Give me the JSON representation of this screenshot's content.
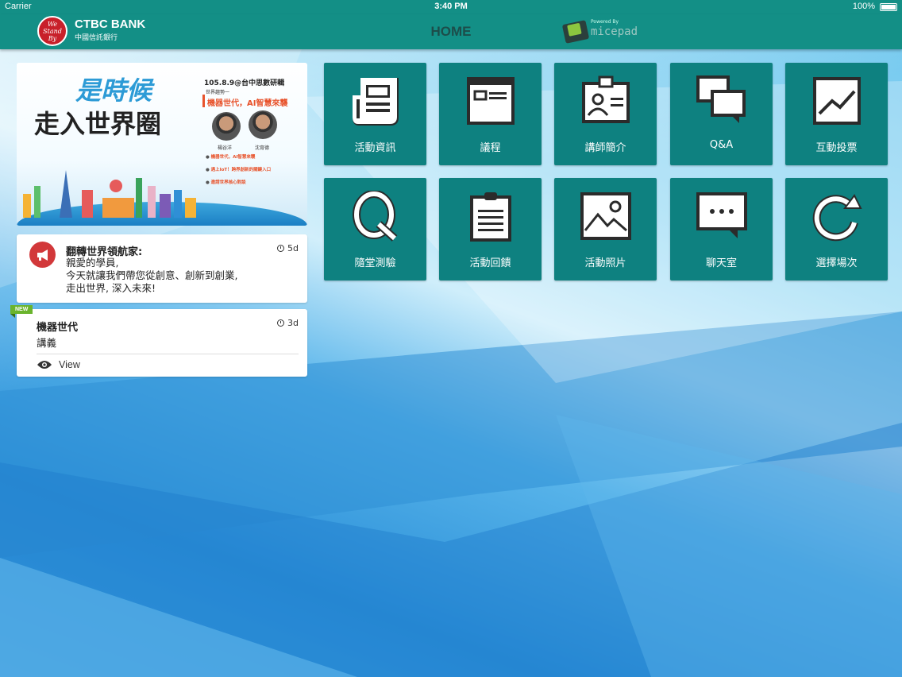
{
  "status_bar": {
    "carrier": "Carrier",
    "time": "3:40 PM",
    "battery": "100%"
  },
  "header": {
    "logo_text": "We Stand By",
    "brand_en": "CTBC BANK",
    "brand_zh": "中國信託銀行",
    "title": "HOME",
    "powered_by": "Powered By",
    "powered_brand": "micepad"
  },
  "banner": {
    "headline_top": "是時候",
    "headline_bottom": "走入世界圈",
    "date": "105.8.9@台中思數研輯",
    "subtitle_label": "世界趨勢一",
    "subtitle": "機器世代，AI智慧來襲",
    "speaker1": "楊谷洋",
    "speaker2": "沈育德",
    "bullets": [
      "機器世代，AI智慧來襲",
      "遇上IoT！跨界創新的關鍵入口",
      "邀請世界核心對談"
    ]
  },
  "announcement": {
    "title": "翻轉世界領航家:",
    "body": "親愛的學員,\n今天就讓我們帶您從創意、創新到創業,\n走出世界, 深入未來!",
    "age": "5d"
  },
  "document": {
    "badge": "NEW",
    "title": "機器世代",
    "subtitle": "講義",
    "age": "3d",
    "action": "View"
  },
  "tiles": [
    {
      "label": "活動資訊",
      "icon": "newspaper-icon"
    },
    {
      "label": "議程",
      "icon": "agenda-icon"
    },
    {
      "label": "講師簡介",
      "icon": "id-card-icon"
    },
    {
      "label": "Q&A",
      "icon": "chat-bubbles-icon"
    },
    {
      "label": "互動投票",
      "icon": "line-chart-icon"
    },
    {
      "label": "隨堂測驗",
      "icon": "q-letter-icon"
    },
    {
      "label": "活動回饋",
      "icon": "clipboard-icon"
    },
    {
      "label": "活動照片",
      "icon": "picture-icon"
    },
    {
      "label": "聊天室",
      "icon": "message-dots-icon"
    },
    {
      "label": "選擇場次",
      "icon": "refresh-icon"
    }
  ]
}
